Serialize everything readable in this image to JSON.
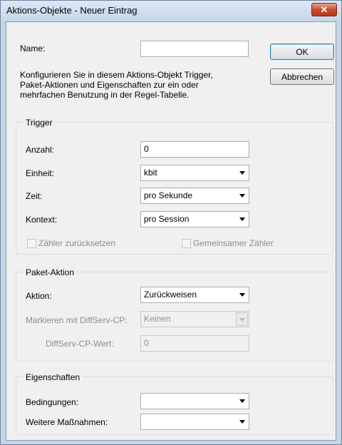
{
  "window": {
    "title": "Aktions-Objekte - Neuer Eintrag",
    "close_label": "✕"
  },
  "name": {
    "label": "Name:",
    "value": ""
  },
  "buttons": {
    "ok": "OK",
    "cancel": "Abbrechen"
  },
  "description": [
    "Konfigurieren Sie in diesem Aktions-Objekt Trigger,",
    "Paket-Aktionen und Eigenschaften zur ein oder",
    "mehrfachen Benutzung in der Regel-Tabelle."
  ],
  "trigger": {
    "title": "Trigger",
    "anzahl_label": "Anzahl:",
    "anzahl_value": "0",
    "einheit_label": "Einheit:",
    "einheit_value": "kbit",
    "zeit_label": "Zeit:",
    "zeit_value": "pro Sekunde",
    "kontext_label": "Kontext:",
    "kontext_value": "pro Session",
    "reset_label": "Zähler zurücksetzen",
    "shared_label": "Gemeinsamer Zähler"
  },
  "paket": {
    "title": "Paket-Aktion",
    "aktion_label": "Aktion:",
    "aktion_value": "Zurückweisen",
    "markieren_label": "Markieren mit DiffServ-CP:",
    "markieren_value": "Keinen",
    "cp_label": "DiffServ-CP-Wert:",
    "cp_value": "0"
  },
  "eigenschaften": {
    "title": "Eigenschaften",
    "bedingungen_label": "Bedingungen:",
    "bedingungen_value": "",
    "weitere_label": "Weitere Maßnahmen:",
    "weitere_value": ""
  }
}
